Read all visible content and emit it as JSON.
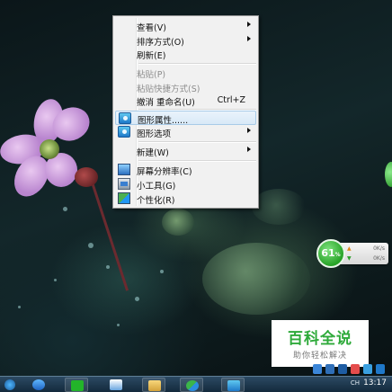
{
  "context_menu": {
    "items": [
      {
        "label": "查看(V)",
        "submenu": true,
        "disabled": false
      },
      {
        "label": "排序方式(O)",
        "submenu": true,
        "disabled": false
      },
      {
        "label": "刷新(E)",
        "submenu": false,
        "disabled": false
      },
      {
        "label": "粘贴(P)",
        "submenu": false,
        "disabled": true
      },
      {
        "label": "粘贴快捷方式(S)",
        "submenu": false,
        "disabled": true
      },
      {
        "label": "撤消 重命名(U)",
        "shortcut": "Ctrl+Z",
        "submenu": false,
        "disabled": false
      },
      {
        "label": "图形属性......",
        "submenu": false,
        "disabled": false,
        "highlighted": true,
        "icon": "graphics-display-icon"
      },
      {
        "label": "图形选项",
        "submenu": true,
        "disabled": false,
        "icon": "graphics-display-icon"
      },
      {
        "label": "新建(W)",
        "submenu": true,
        "disabled": false
      },
      {
        "label": "屏幕分辨率(C)",
        "submenu": false,
        "disabled": false,
        "icon": "screen-resolution-icon"
      },
      {
        "label": "小工具(G)",
        "submenu": false,
        "disabled": false,
        "icon": "gadgets-icon"
      },
      {
        "label": "个性化(R)",
        "submenu": false,
        "disabled": false,
        "icon": "personalize-icon"
      }
    ]
  },
  "net_widget": {
    "percent": "61",
    "percent_unit": "%",
    "upload_value": "0K/s",
    "download_value": "0K/s"
  },
  "watermark": {
    "title": "百科全说",
    "subtitle": "助你轻松解决"
  },
  "taskbar": {
    "tray_text": "CH",
    "clock": "13:17"
  },
  "colors": {
    "menu_bg": "#f1f1f1",
    "highlight_bg": "#d8e9f7",
    "watermark_green": "#2eaa3a",
    "widget_green": "#27a327",
    "taskbar": "#1c3a52"
  }
}
